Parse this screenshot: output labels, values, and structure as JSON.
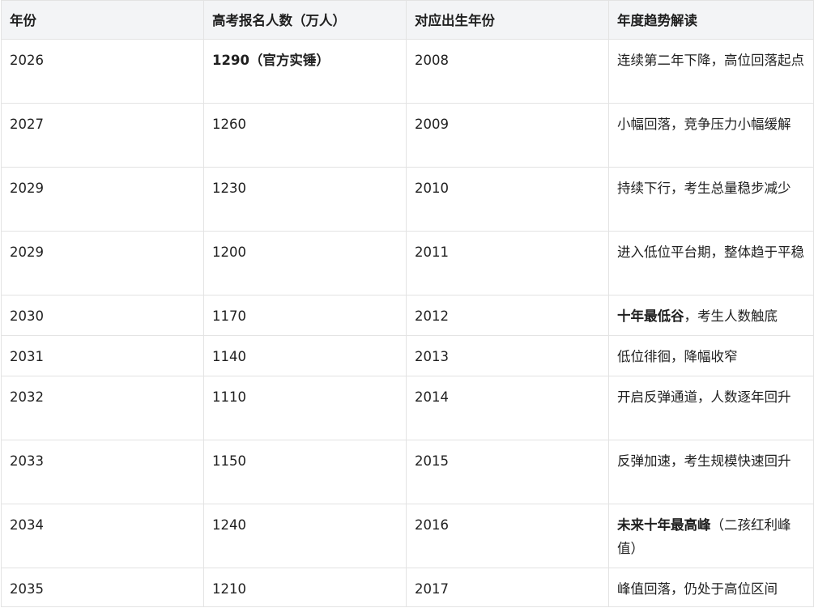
{
  "headers": [
    "年份",
    "高考报名人数（万人）",
    "对应出生年份",
    "年度趋势解读"
  ],
  "rows": [
    {
      "year": "2026",
      "count": "1290（官方实锤）",
      "count_bold": true,
      "birth": "2008",
      "trend_bold": "",
      "trend": "连续第二年下降，高位回落起点"
    },
    {
      "year": "2027",
      "count": "1260",
      "count_bold": false,
      "birth": "2009",
      "trend_bold": "",
      "trend": "小幅回落，竞争压力小幅缓解"
    },
    {
      "year": "2029",
      "count": "1230",
      "count_bold": false,
      "birth": "2010",
      "trend_bold": "",
      "trend": "持续下行，考生总量稳步减少"
    },
    {
      "year": "2029",
      "count": "1200",
      "count_bold": false,
      "birth": "2011",
      "trend_bold": "",
      "trend": "进入低位平台期，整体趋于平稳"
    },
    {
      "year": "2030",
      "count": "1170",
      "count_bold": false,
      "birth": "2012",
      "trend_bold": "十年最低谷",
      "trend": "，考生人数触底"
    },
    {
      "year": "2031",
      "count": "1140",
      "count_bold": false,
      "birth": "2013",
      "trend_bold": "",
      "trend": "低位徘徊，降幅收窄"
    },
    {
      "year": "2032",
      "count": "1110",
      "count_bold": false,
      "birth": "2014",
      "trend_bold": "",
      "trend": "开启反弹通道，人数逐年回升"
    },
    {
      "year": "2033",
      "count": "1150",
      "count_bold": false,
      "birth": "2015",
      "trend_bold": "",
      "trend": "反弹加速，考生规模快速回升"
    },
    {
      "year": "2034",
      "count": "1240",
      "count_bold": false,
      "birth": "2016",
      "trend_bold": "未来十年最高峰",
      "trend": "（二孩红利峰值）"
    },
    {
      "year": "2035",
      "count": "1210",
      "count_bold": false,
      "birth": "2017",
      "trend_bold": "",
      "trend": "峰值回落，仍处于高位区间"
    }
  ]
}
